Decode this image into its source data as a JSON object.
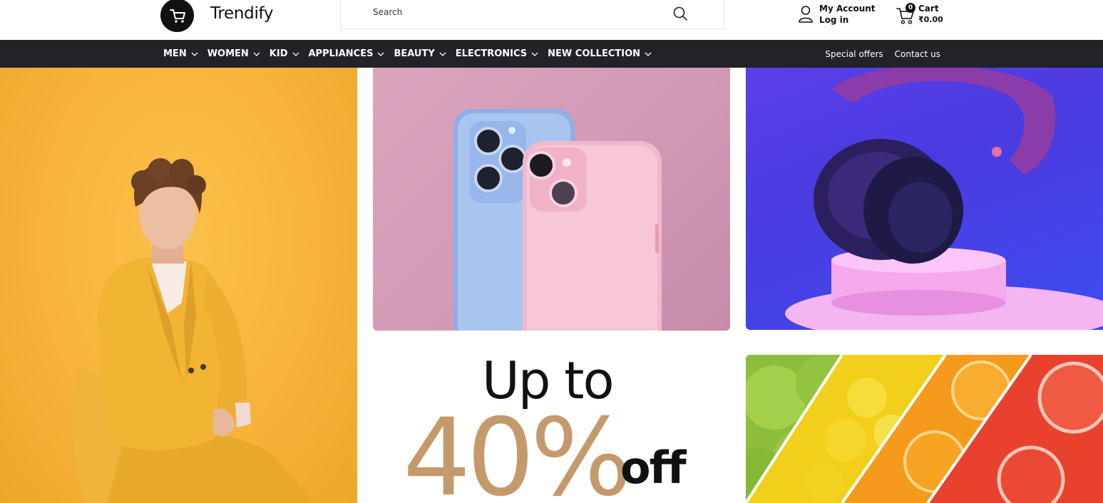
{
  "header": {
    "brand": "Trendify",
    "search": {
      "placeholder": "Search"
    },
    "account": {
      "title": "My Account",
      "subtitle": "Log in"
    },
    "cart": {
      "title": "Cart",
      "count": "0",
      "amount": "₹0.00"
    }
  },
  "nav": {
    "items": [
      {
        "label": "MEN"
      },
      {
        "label": "WOMEN"
      },
      {
        "label": "KID"
      },
      {
        "label": "APPLIANCES"
      },
      {
        "label": "BEAUTY"
      },
      {
        "label": "ELECTRONICS"
      },
      {
        "label": "NEW COLLECTION"
      }
    ],
    "links": [
      {
        "label": "Special offers"
      },
      {
        "label": "Contact us"
      }
    ]
  },
  "promo": {
    "line1": "Up to",
    "percent": "40%",
    "suffix": "off"
  },
  "colors": {
    "nav_background": "#232327",
    "promo_accent": "#c49a6c",
    "tile_man_bg": "#f7b33a",
    "tile_phones_bg": "#d39bb5",
    "tile_headphones_bg": "#4a3be0"
  },
  "icons": {
    "logo": "shopping-cart-icon",
    "search": "search-icon",
    "account": "user-icon",
    "cart": "cart-icon",
    "dropdown": "chevron-down-icon"
  }
}
